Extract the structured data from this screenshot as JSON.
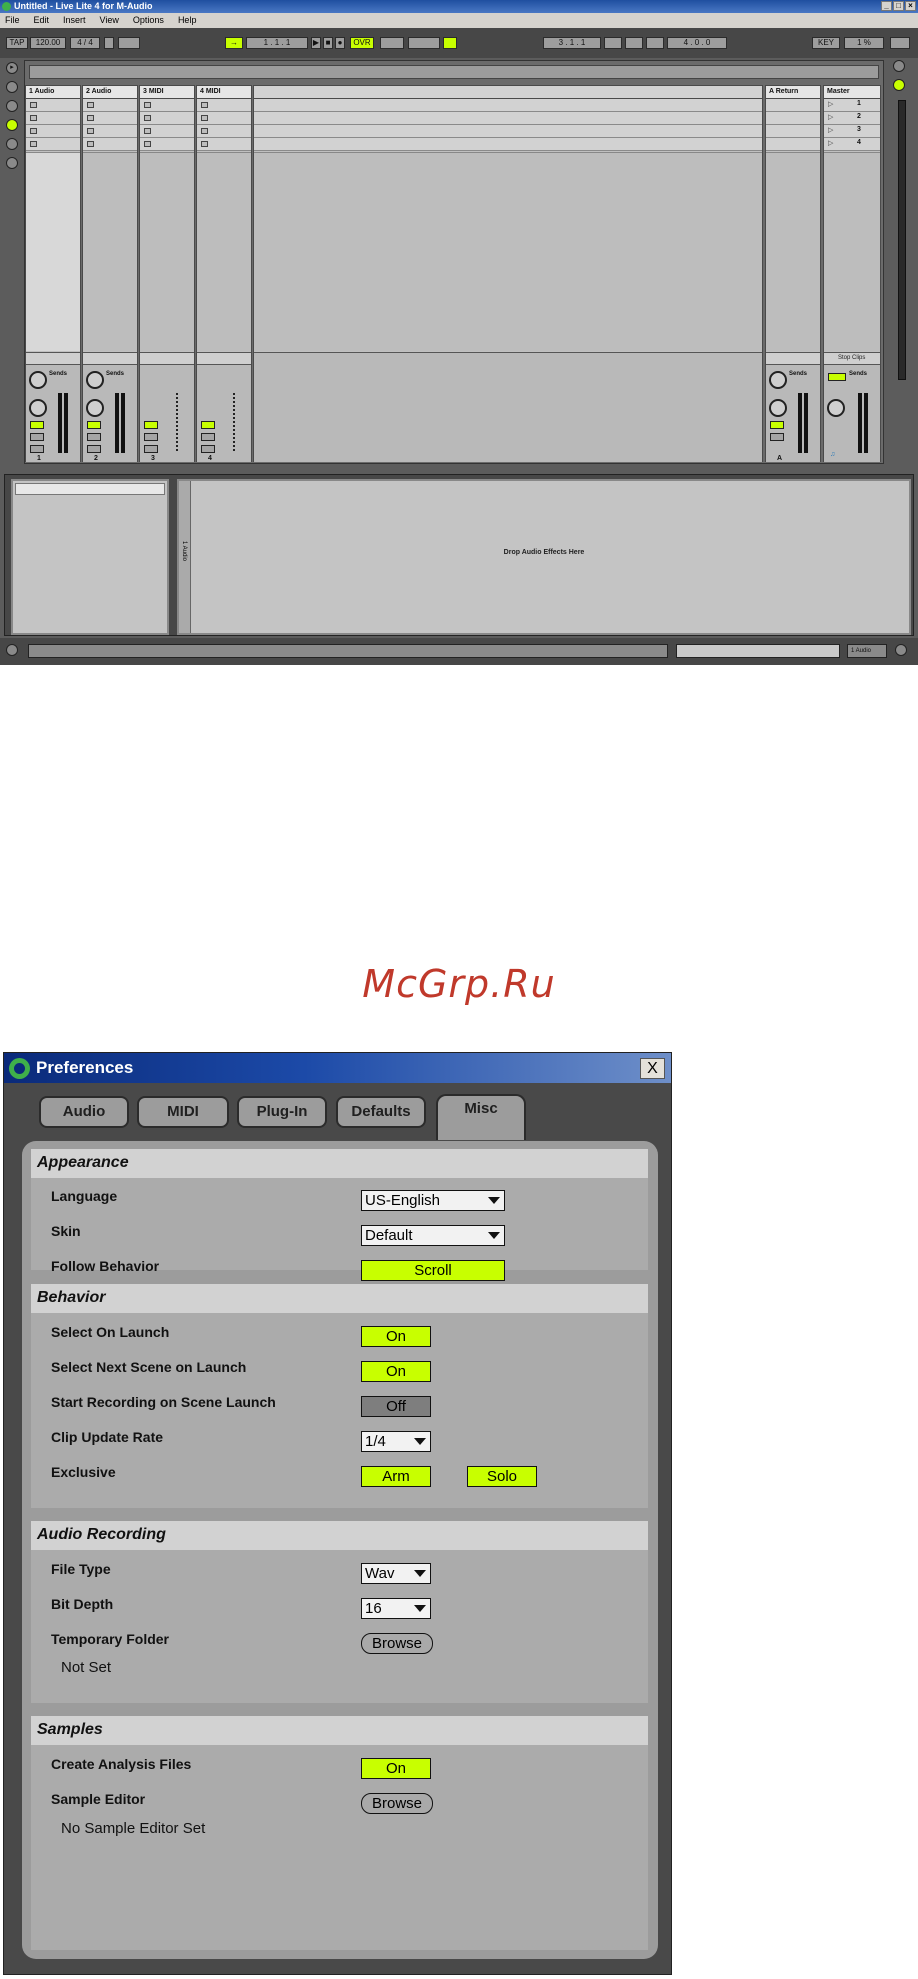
{
  "live": {
    "title": "Untitled - Live Lite 4 for M-Audio",
    "menu": [
      "File",
      "Edit",
      "Insert",
      "View",
      "Options",
      "Help"
    ],
    "transport": {
      "tap": "TAP",
      "tempo": "120.00",
      "signature": "4 / 4",
      "position": "1 . 1 . 1",
      "ovr": "OVR",
      "loop_start": "3 . 1 . 1",
      "loop_length": "4 . 0 . 0",
      "key": "KEY",
      "cpu": "1 %"
    },
    "tracks": [
      {
        "name": "1 Audio",
        "number": "1"
      },
      {
        "name": "2 Audio",
        "number": "2"
      },
      {
        "name": "3 MIDI",
        "number": "3"
      },
      {
        "name": "4 MIDI",
        "number": "4"
      }
    ],
    "return_track": {
      "name": "A Return",
      "letter": "A"
    },
    "master_track": {
      "name": "Master",
      "scenes": [
        "1",
        "2",
        "3",
        "4"
      ],
      "stop_clips": "Stop Clips"
    },
    "sends_label": "Sends",
    "drop_text": "Drop Audio Effects Here",
    "detail_side_label": "1 Audio",
    "status_track": "1 Audio"
  },
  "watermark": "McGrp.Ru",
  "preferences": {
    "title": "Preferences",
    "close_symbol": "X",
    "tabs": [
      "Audio",
      "MIDI",
      "Plug-In",
      "Defaults",
      "Misc"
    ],
    "active_tab": "Misc",
    "appearance": {
      "heading": "Appearance",
      "language_label": "Language",
      "language_value": "US-English",
      "skin_label": "Skin",
      "skin_value": "Default",
      "follow_label": "Follow Behavior",
      "follow_value": "Scroll"
    },
    "behavior": {
      "heading": "Behavior",
      "select_on_launch_label": "Select On Launch",
      "select_on_launch_value": "On",
      "select_next_label": "Select Next Scene on Launch",
      "select_next_value": "On",
      "start_rec_label": "Start Recording on Scene Launch",
      "start_rec_value": "Off",
      "clip_rate_label": "Clip Update Rate",
      "clip_rate_value": "1/4",
      "exclusive_label": "Exclusive",
      "arm_value": "Arm",
      "solo_value": "Solo"
    },
    "audio_recording": {
      "heading": "Audio Recording",
      "file_type_label": "File Type",
      "file_type_value": "Wav",
      "bit_depth_label": "Bit Depth",
      "bit_depth_value": "16",
      "temp_folder_label": "Temporary Folder",
      "browse_label": "Browse",
      "temp_folder_status": "Not Set"
    },
    "samples": {
      "heading": "Samples",
      "analysis_label": "Create Analysis Files",
      "analysis_value": "On",
      "editor_label": "Sample Editor",
      "browse_label": "Browse",
      "editor_status": "No Sample Editor Set"
    }
  }
}
